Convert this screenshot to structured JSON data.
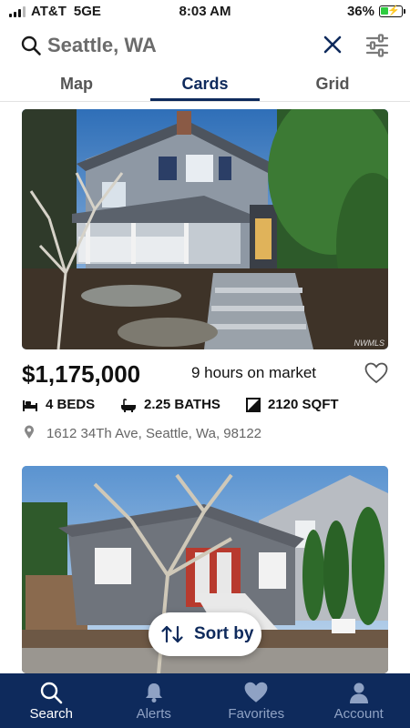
{
  "status_bar": {
    "carrier": "AT&T",
    "network": "5GE",
    "time": "8:03 AM",
    "battery_percent_label": "36%",
    "battery_level": 0.36
  },
  "search": {
    "location": "Seattle, WA"
  },
  "tabs": [
    {
      "label": "Map",
      "active": false
    },
    {
      "label": "Cards",
      "active": true
    },
    {
      "label": "Grid",
      "active": false
    }
  ],
  "listings": [
    {
      "price": "$1,175,000",
      "time_on_market": "9 hours on market",
      "beds": "4 BEDS",
      "baths": "2.25 BATHS",
      "sqft": "2120 SQFT",
      "address": "1612 34Th Ave, Seattle, Wa, 98122",
      "watermark": "NWMLS"
    }
  ],
  "sort": {
    "label": "Sort by"
  },
  "bottom_nav": [
    {
      "label": "Search",
      "icon": "search-icon",
      "active": true
    },
    {
      "label": "Alerts",
      "icon": "bell-icon",
      "active": false
    },
    {
      "label": "Favorites",
      "icon": "heart-icon",
      "active": false
    },
    {
      "label": "Account",
      "icon": "person-icon",
      "active": false
    }
  ],
  "colors": {
    "brand_navy": "#0e2a5c",
    "battery_green": "#2ecc40",
    "inactive_nav": "#8fa2c4"
  }
}
